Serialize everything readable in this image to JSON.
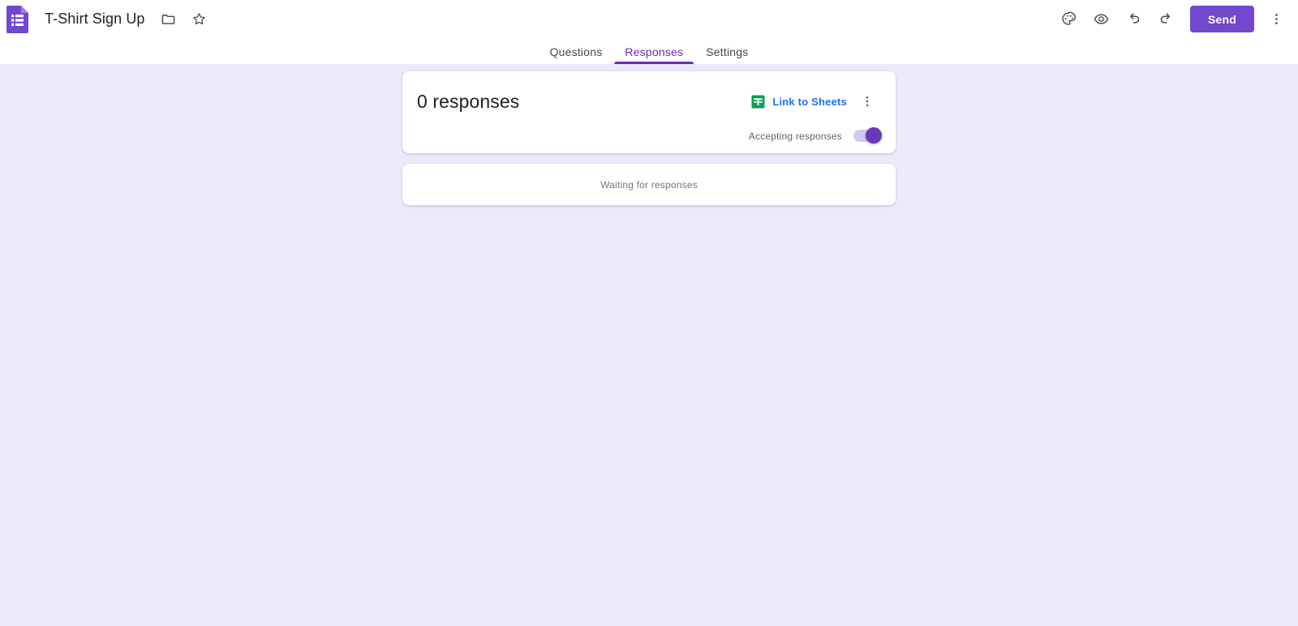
{
  "header": {
    "app_icon": "google-forms-icon",
    "doc_title": "T-Shirt Sign Up",
    "move_folder_icon": "folder-icon",
    "star_icon": "star-icon",
    "theme_icon": "palette-icon",
    "preview_icon": "eye-icon",
    "undo_icon": "undo-icon",
    "redo_icon": "redo-icon",
    "send_label": "Send",
    "more_icon": "more-vert-icon",
    "accent_color": "#7248cf"
  },
  "tabs": [
    {
      "label": "Questions",
      "active": false
    },
    {
      "label": "Responses",
      "active": true
    },
    {
      "label": "Settings",
      "active": false
    }
  ],
  "summary": {
    "responses_count": "0 responses",
    "link_to_sheets": "Link to Sheets",
    "sheets_icon": "google-sheets-icon",
    "more_icon": "more-vert-icon",
    "accepting_label": "Accepting responses",
    "accepting_state": "on",
    "link_color": "#1a73e8",
    "toggle_color": "#6639ba"
  },
  "empty_state": {
    "message": "Waiting for responses"
  },
  "colors": {
    "page_background": "#ece9fb",
    "card_background": "#ffffff",
    "tab_active": "#6d28c4"
  }
}
